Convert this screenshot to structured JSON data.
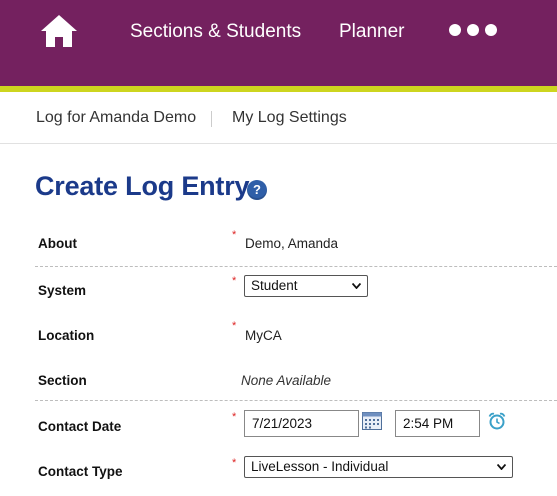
{
  "colors": {
    "brand": "#74215f",
    "accent": "#cdd51f",
    "title": "#1b3a8a",
    "required": "#dd2222"
  },
  "topnav": {
    "home_icon": "home-icon",
    "items": [
      {
        "label": "Sections & Students"
      },
      {
        "label": "Planner"
      }
    ],
    "more_icon": "more-dots-icon"
  },
  "subnav": {
    "log_link": "Log for Amanda Demo",
    "settings_link": "My Log Settings"
  },
  "page": {
    "title": "Create Log Entry",
    "help_icon": "help-icon",
    "help_glyph": "?"
  },
  "form": {
    "required_mark": "*",
    "about": {
      "label": "About",
      "value": "Demo, Amanda"
    },
    "system": {
      "label": "System",
      "selected": "Student"
    },
    "location": {
      "label": "Location",
      "value": "MyCA"
    },
    "section": {
      "label": "Section",
      "value": "None Available"
    },
    "contact_date": {
      "label": "Contact Date",
      "date": "7/21/2023",
      "time": "2:54 PM",
      "calendar_icon": "calendar-icon",
      "clock_icon": "alarm-clock-icon"
    },
    "contact_type": {
      "label": "Contact Type",
      "selected": "LiveLesson - Individual"
    }
  }
}
